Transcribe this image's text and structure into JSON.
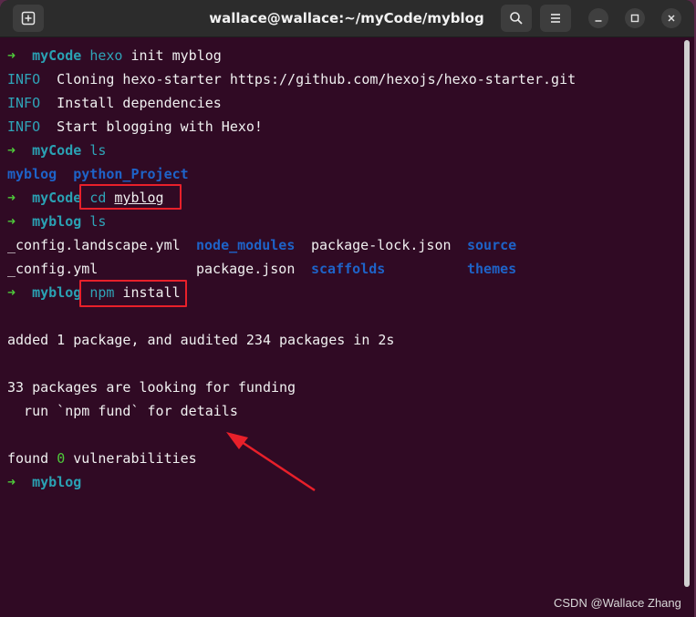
{
  "window": {
    "title": "wallace@wallace:~/myCode/myblog"
  },
  "titlebar_icons": {
    "new_tab": "new-tab-icon",
    "search": "search-icon",
    "menu": "hamburger-menu-icon",
    "minimize": "minimize-icon",
    "maximize": "maximize-icon",
    "close": "close-icon"
  },
  "terminal": {
    "prompt_arrow": "➜",
    "lines": [
      {
        "dir": "myCode",
        "cmd": "hexo",
        "args": " init myblog"
      },
      {
        "tag": "INFO",
        "text": "  Cloning hexo-starter https://github.com/hexojs/hexo-starter.git"
      },
      {
        "tag": "INFO",
        "text": "  Install dependencies"
      },
      {
        "tag": "INFO",
        "text": "  Start blogging with Hexo!"
      },
      {
        "dir": "myCode",
        "cmd": "ls",
        "args": ""
      },
      {
        "folders": [
          "myblog",
          "python_Project"
        ]
      },
      {
        "dir": "myCode",
        "cmd": "cd",
        "args": "myblog"
      },
      {
        "dir": "myblog",
        "cmd": "ls",
        "args": ""
      },
      {
        "files_row1": [
          "_config.landscape.yml",
          "node_modules",
          "package-lock.json",
          "source"
        ]
      },
      {
        "files_row2": [
          "_config.yml",
          "package.json",
          "scaffolds",
          "themes"
        ]
      },
      {
        "dir": "myblog",
        "cmd": "npm",
        "args": " install"
      },
      {
        "text": ""
      },
      {
        "text": "added 1 package, and audited 234 packages in 2s"
      },
      {
        "text": ""
      },
      {
        "text": "33 packages are looking for funding"
      },
      {
        "text": "  run `npm fund` for details"
      },
      {
        "text": ""
      },
      {
        "found_pre": "found ",
        "found_num": "0",
        "found_post": " vulnerabilities"
      },
      {
        "dir": "myblog",
        "cmd": "",
        "args": ""
      }
    ]
  },
  "watermark": "CSDN @Wallace Zhang",
  "colors": {
    "background": "#300a24",
    "arrow": "#4ec93a",
    "directory": "#2aa1b3",
    "folder": "#1e63c8",
    "highlight": "#e8202a"
  }
}
